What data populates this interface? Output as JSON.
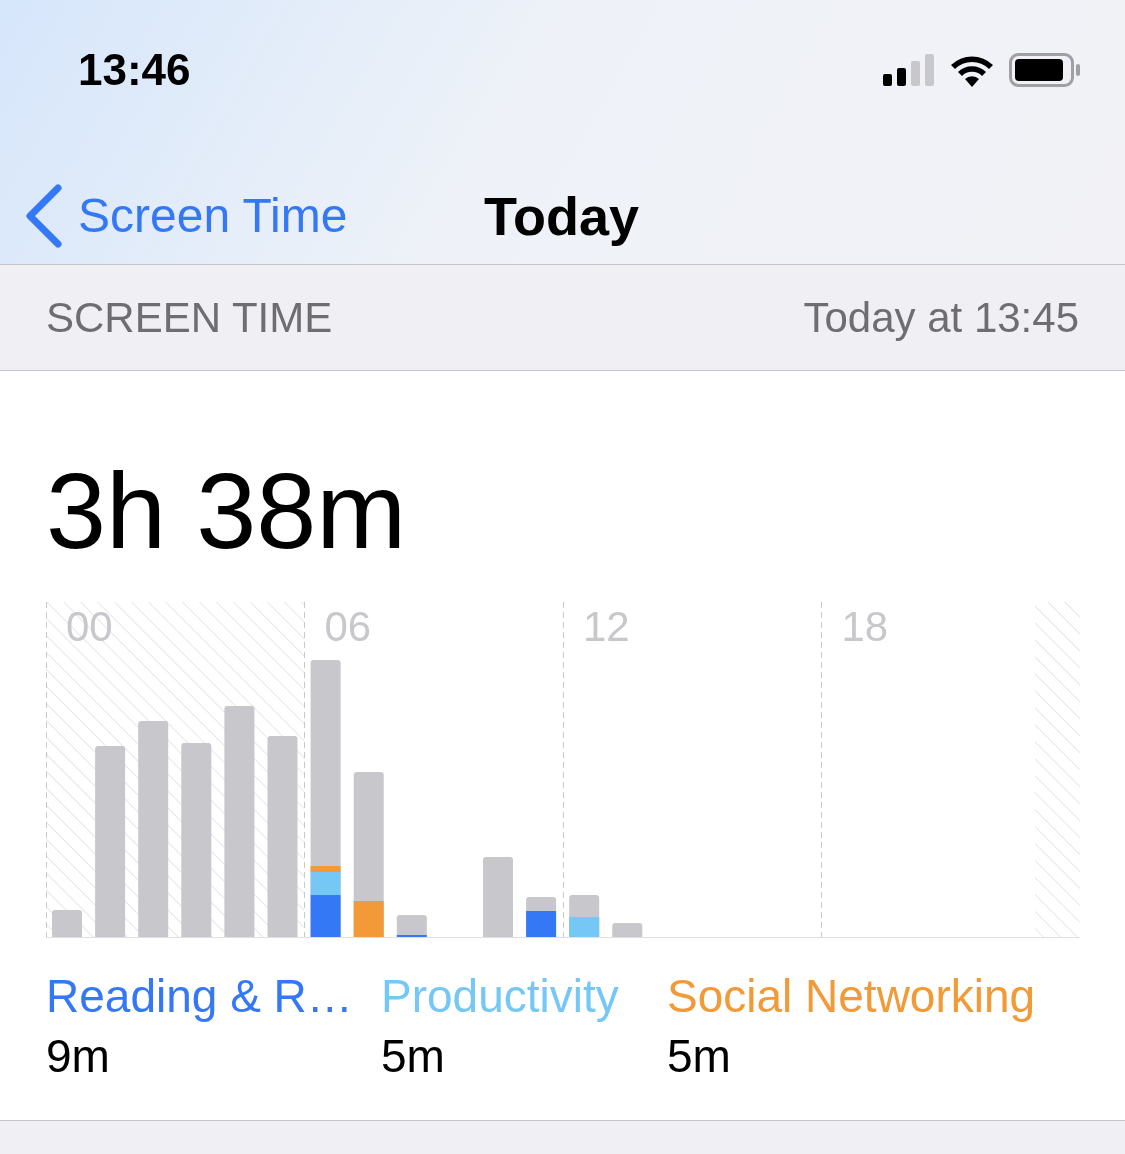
{
  "status_bar": {
    "time": "13:46"
  },
  "nav": {
    "back": "Screen Time",
    "title": "Today"
  },
  "section_header": {
    "title": "SCREEN TIME",
    "updated": "Today at 13:45"
  },
  "total": "3h 38m",
  "chart": {
    "hour_labels": [
      "00",
      "06",
      "12",
      "18"
    ]
  },
  "categories": [
    {
      "name": "Reading & R…",
      "time": "9m",
      "color": "#3478f6"
    },
    {
      "name": "Productivity",
      "time": "5m",
      "color": "#75c8f6"
    },
    {
      "name": "Social Networking",
      "time": "5m",
      "color": "#f19a37"
    }
  ]
}
